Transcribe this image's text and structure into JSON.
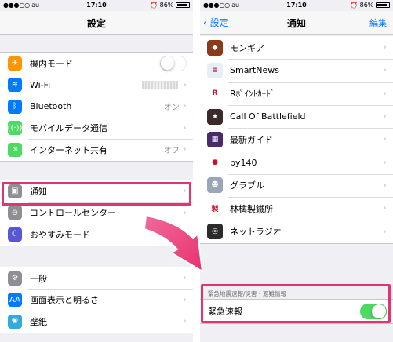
{
  "colors": {
    "accent": "#007aff",
    "highlight": "#e8326e",
    "toggle_on": "#4cd964"
  },
  "left": {
    "status": {
      "carrier": "●●●○○ au",
      "time": "17:10",
      "battery": "86%"
    },
    "title": "設定",
    "groups": [
      [
        {
          "name": "airplane-mode",
          "icon": "airplane-icon",
          "icon_color": "#ff9500",
          "glyph": "✈",
          "label": "機内モード",
          "control": "toggle-off"
        },
        {
          "name": "wifi",
          "icon": "wifi-icon",
          "icon_color": "#007aff",
          "glyph": "≋",
          "label": "Wi-Fi",
          "control": "blur"
        },
        {
          "name": "bluetooth",
          "icon": "bluetooth-icon",
          "icon_color": "#007aff",
          "glyph": "ᛒ",
          "label": "Bluetooth",
          "value": "オン"
        },
        {
          "name": "mobile-data",
          "icon": "antenna-icon",
          "icon_color": "#4cd964",
          "glyph": "((·))",
          "label": "モバイルデータ通信"
        },
        {
          "name": "hotspot",
          "icon": "hotspot-icon",
          "icon_color": "#4cd964",
          "glyph": "∞",
          "label": "インターネット共有",
          "value": "オフ"
        }
      ],
      [
        {
          "name": "notifications",
          "icon": "notifications-icon",
          "icon_color": "#8e8e93",
          "glyph": "▣",
          "label": "通知"
        },
        {
          "name": "control-center",
          "icon": "control-center-icon",
          "icon_color": "#8e8e93",
          "glyph": "⊜",
          "label": "コントロールセンター"
        },
        {
          "name": "do-not-disturb",
          "icon": "moon-icon",
          "icon_color": "#5856d6",
          "glyph": "☾",
          "label": "おやすみモード"
        }
      ],
      [
        {
          "name": "general",
          "icon": "gear-icon",
          "icon_color": "#8e8e93",
          "glyph": "⚙",
          "label": "一般"
        },
        {
          "name": "display-brightness",
          "icon": "display-icon",
          "icon_color": "#007aff",
          "glyph": "AA",
          "label": "画面表示と明るさ"
        },
        {
          "name": "wallpaper",
          "icon": "wallpaper-icon",
          "icon_color": "#34aadc",
          "glyph": "❀",
          "label": "壁紙"
        }
      ]
    ]
  },
  "right": {
    "status": {
      "carrier": "●●●○○ au",
      "time": "17:10",
      "battery": "86%"
    },
    "back": "設定",
    "title": "通知",
    "edit": "編集",
    "apps": [
      {
        "name": "monster-gear",
        "icon": "monster-gear-icon",
        "icon_color": "#8b3a1a",
        "glyph": "◆",
        "label": "モンギア"
      },
      {
        "name": "smartnews",
        "icon": "smartnews-icon",
        "icon_color": "#e6eef6",
        "glyph": "≡",
        "label": "SmartNews"
      },
      {
        "name": "r-point-card",
        "icon": "r-point-card-icon",
        "icon_color": "#ffffff",
        "glyph": "R",
        "label": "Rﾎﾟｲﾝﾄｶｰﾄﾞ"
      },
      {
        "name": "call-of-battlefield",
        "icon": "call-of-battlefield-icon",
        "icon_color": "#3a2a2a",
        "glyph": "★",
        "label": "Call Of Battlefield"
      },
      {
        "name": "saishin-guide",
        "icon": "guide-icon",
        "icon_color": "#4a2a6a",
        "glyph": "▦",
        "label": "最新ガイド"
      },
      {
        "name": "by140",
        "icon": "by140-icon",
        "icon_color": "#ffffff",
        "glyph": "●",
        "label": "by140"
      },
      {
        "name": "granblue",
        "icon": "granblue-icon",
        "icon_color": "#9aa6b8",
        "glyph": "☻",
        "label": "グラブル"
      },
      {
        "name": "ringo-seitetsusho",
        "icon": "ringo-icon",
        "icon_color": "#ffffff",
        "glyph": "製",
        "label": "林檎製鐵所"
      },
      {
        "name": "net-radio",
        "icon": "radio-icon",
        "icon_color": "#2b2b2b",
        "glyph": "◎",
        "label": "ネットラジオ"
      }
    ],
    "emergency_header": "緊急地震速報/災害・避難情報",
    "emergency_label": "緊急速報"
  }
}
